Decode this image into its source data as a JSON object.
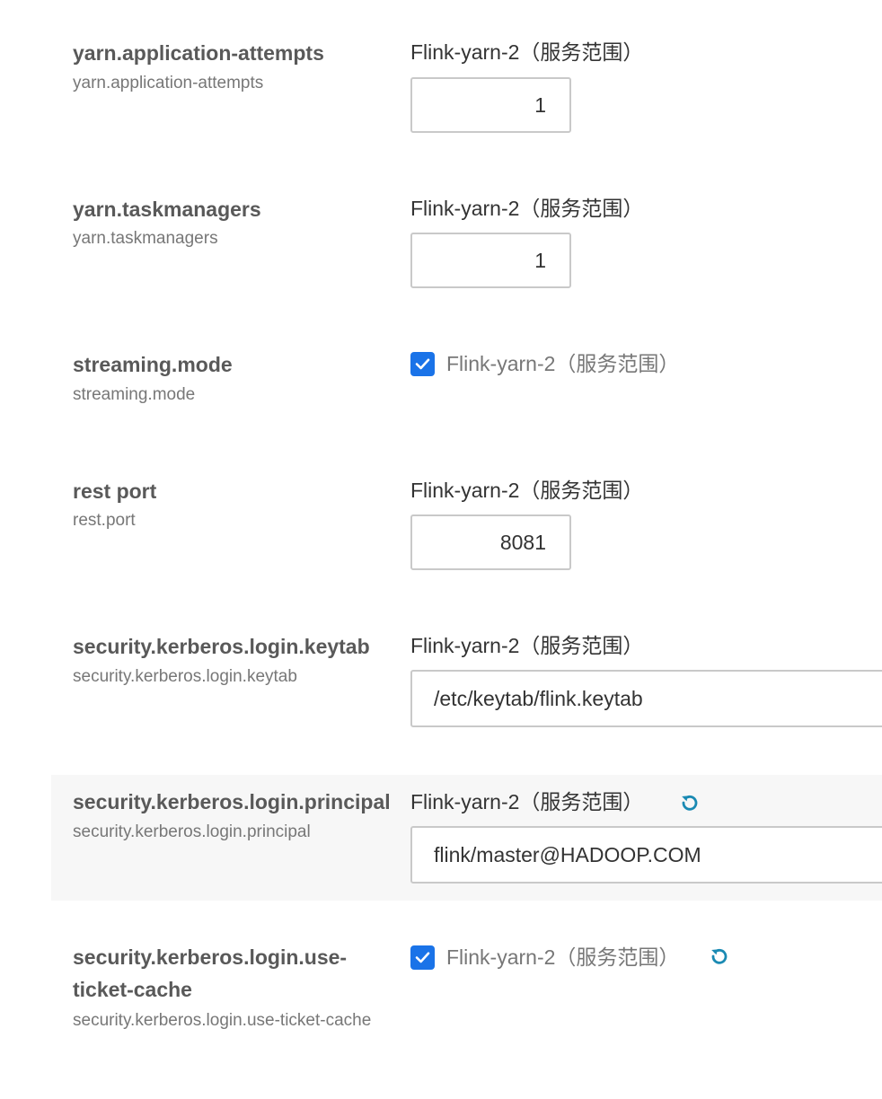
{
  "colors": {
    "checkbox": "#1a73e8",
    "reset_icon": "#1a8ab3",
    "highlight_row": "#f7f7f7"
  },
  "rows": [
    {
      "name": "yarn.application-attempts",
      "key": "yarn.application-attempts",
      "scope": "Flink-yarn-2（服务范围）",
      "control": "number",
      "value": "1"
    },
    {
      "name": "yarn.taskmanagers",
      "key": "yarn.taskmanagers",
      "scope": "Flink-yarn-2（服务范围）",
      "control": "number",
      "value": "1"
    },
    {
      "name": "streaming.mode",
      "key": "streaming.mode",
      "scope": "Flink-yarn-2（服务范围）",
      "control": "checkbox",
      "checked": true
    },
    {
      "name": "rest port",
      "key": "rest.port",
      "scope": "Flink-yarn-2（服务范围）",
      "control": "number",
      "value": "8081"
    },
    {
      "name": "security.kerberos.login.keytab",
      "key": "security.kerberos.login.keytab",
      "scope": "Flink-yarn-2（服务范围）",
      "control": "text",
      "value": "/etc/keytab/flink.keytab"
    },
    {
      "name": "security.kerberos.login.principal",
      "key": "security.kerberos.login.principal",
      "scope": "Flink-yarn-2（服务范围）",
      "control": "text",
      "value": "flink/master@HADOOP.COM",
      "reset_icon": "undo-icon"
    },
    {
      "name": "security.kerberos.login.use-ticket-cache",
      "key": "security.kerberos.login.use-ticket-cache",
      "scope": "Flink-yarn-2（服务范围）",
      "control": "checkbox",
      "checked": true,
      "reset_icon": "undo-icon"
    }
  ]
}
